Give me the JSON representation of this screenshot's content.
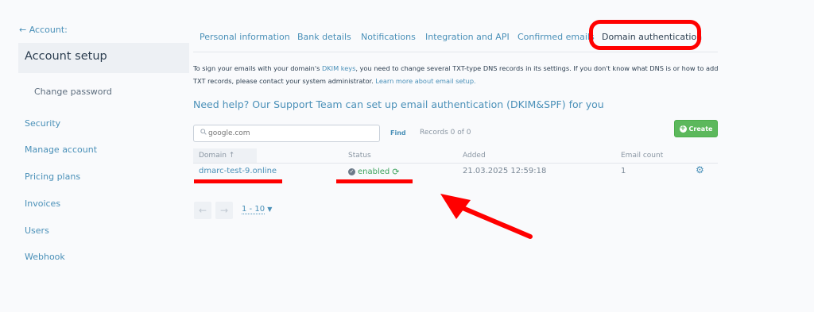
{
  "sidebar": {
    "back": "← Account:",
    "title": "Account setup",
    "sub_item": "Change password",
    "items": [
      {
        "label": "Security"
      },
      {
        "label": "Manage account"
      },
      {
        "label": "Pricing plans"
      },
      {
        "label": "Invoices"
      },
      {
        "label": "Users"
      },
      {
        "label": "Webhook"
      }
    ]
  },
  "tabs": [
    {
      "label": "Personal information"
    },
    {
      "label": "Bank details"
    },
    {
      "label": "Notifications"
    },
    {
      "label": "Integration and API"
    },
    {
      "label": "Confirmed emails"
    },
    {
      "label": "Domain authentication",
      "active": true
    }
  ],
  "info": {
    "before": "To sign your emails with your domain's ",
    "dkim_link": "DKIM keys",
    "after": ", you need to change several TXT-type DNS records in its settings. If you don't know what DNS is or how to add TXT records, please contact your system administrator. ",
    "learn_more": "Learn more about email setup."
  },
  "help_text": "Need help? Our Support Team can set up email authentication (DKIM&SPF) for you",
  "search": {
    "placeholder": "google.com",
    "find_label": "Find",
    "records": "Records 0 of 0"
  },
  "create_label": "Create",
  "table": {
    "columns": {
      "domain": "Domain ↑",
      "status": "Status",
      "added": "Added",
      "email_count": "Email count"
    },
    "rows": [
      {
        "domain": "dmarc-test-9.online",
        "status": "enabled",
        "added": "21.03.2025 12:59:18",
        "email_count": "1"
      }
    ]
  },
  "pagination": {
    "range": "1 - 10"
  },
  "icons": [
    "search-icon",
    "plus-circle-icon",
    "check-circle-icon",
    "refresh-icon",
    "gear-icon",
    "arrow-left-icon",
    "arrow-right-icon",
    "caret-down-icon"
  ],
  "colors": {
    "link": "#4a90b8",
    "success": "#5cb85c",
    "annotation": "#ff0000"
  }
}
